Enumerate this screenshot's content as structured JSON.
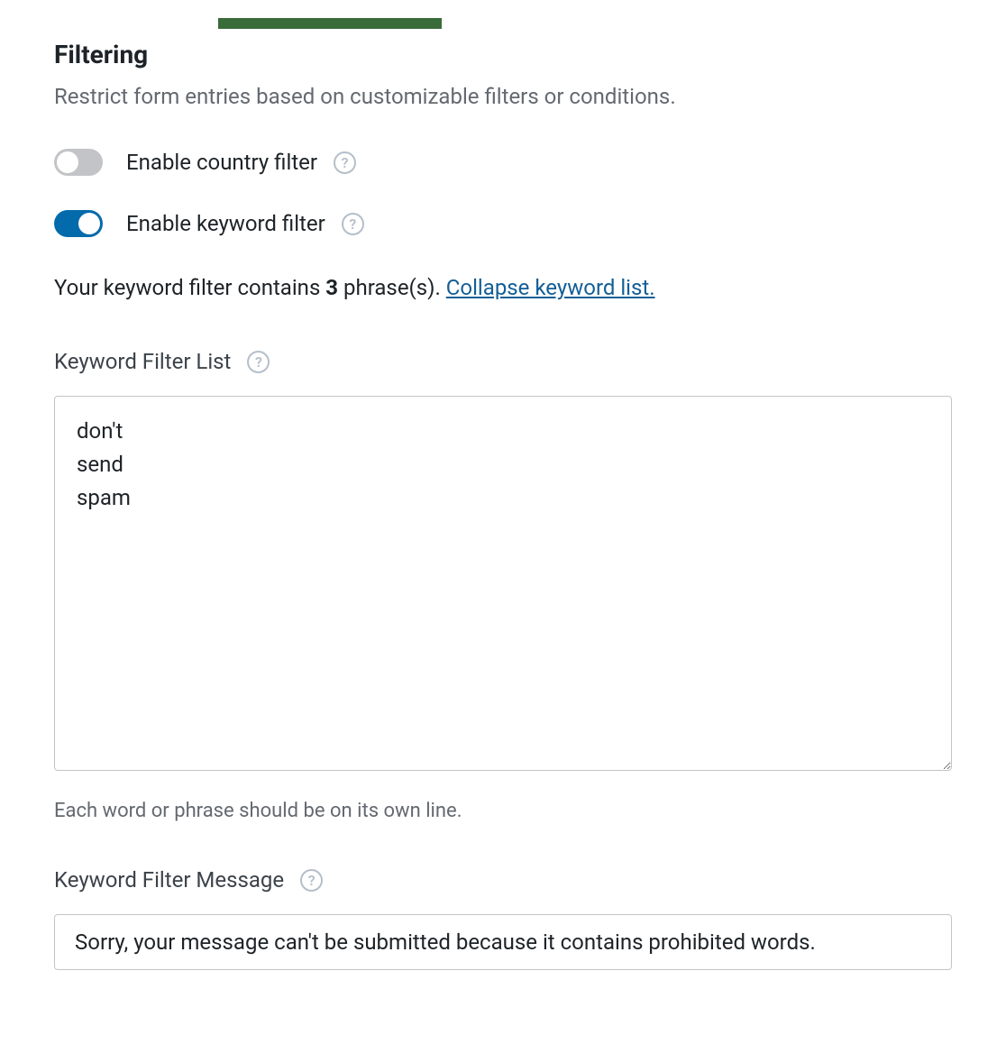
{
  "section": {
    "title": "Filtering",
    "description": "Restrict form entries based on customizable filters or conditions."
  },
  "toggles": {
    "country": {
      "label": "Enable country filter",
      "enabled": false
    },
    "keyword": {
      "label": "Enable keyword filter",
      "enabled": true
    }
  },
  "status": {
    "prefix": "Your keyword filter contains ",
    "count": "3",
    "suffix": " phrase(s). ",
    "collapse_link": "Collapse keyword list."
  },
  "keyword_list": {
    "label": "Keyword Filter List",
    "value": "don't\nsend\nspam",
    "helper": "Each word or phrase should be on its own line."
  },
  "keyword_message": {
    "label": "Keyword Filter Message",
    "value": "Sorry, your message can't be submitted because it contains prohibited words."
  },
  "icons": {
    "help": "?"
  }
}
